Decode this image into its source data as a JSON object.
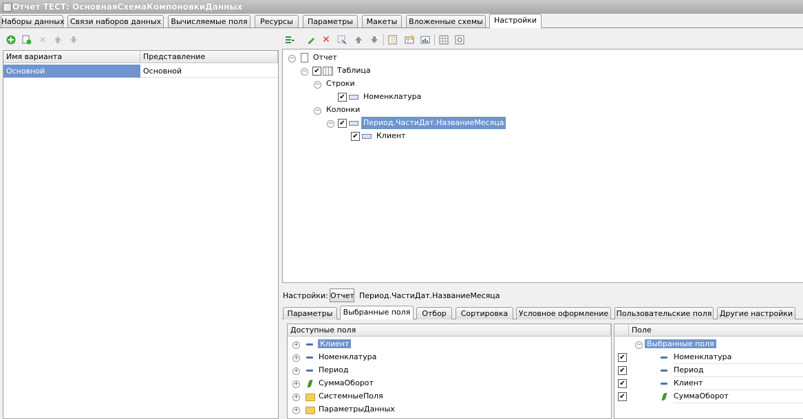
{
  "window": {
    "title": "Отчет ТЕСТ: ОсновнаяСхемаКомпоновкиДанных"
  },
  "tabs": [
    {
      "label": "Наборы данных"
    },
    {
      "label": "Связи наборов данных"
    },
    {
      "label": "Вычисляемые поля"
    },
    {
      "label": "Ресурсы"
    },
    {
      "label": "Параметры"
    },
    {
      "label": "Макеты"
    },
    {
      "label": "Вложенные схемы"
    },
    {
      "label": "Настройки"
    }
  ],
  "active_tab": "Настройки",
  "variants": {
    "col_name": "Имя варианта",
    "col_repr": "Представление",
    "rows": [
      {
        "name": "Основной",
        "repr": "Основной"
      }
    ]
  },
  "structure": {
    "root": "Отчет",
    "table": "Таблица",
    "rows_group": "Строки",
    "rows_field": "Номенклатура",
    "cols_group": "Колонки",
    "cols_field": "Период.ЧастиДат.НазваниеМесяца",
    "cols_subfield": "Клиент"
  },
  "settings_bar": {
    "label": "Настройки:",
    "btn_report": "Отчет",
    "current": "Период.ЧастиДат.НазваниеМесяца"
  },
  "subtabs": [
    {
      "label": "Параметры"
    },
    {
      "label": "Выбранные поля"
    },
    {
      "label": "Отбор"
    },
    {
      "label": "Сортировка"
    },
    {
      "label": "Условное оформление"
    },
    {
      "label": "Пользовательские поля"
    },
    {
      "label": "Другие настройки"
    }
  ],
  "available": {
    "header": "Доступные поля",
    "items": [
      {
        "label": "Клиент",
        "icon": "field-icon"
      },
      {
        "label": "Номенклатура",
        "icon": "field-icon"
      },
      {
        "label": "Период",
        "icon": "field-icon"
      },
      {
        "label": "СуммаОборот",
        "icon": "resource-icon"
      },
      {
        "label": "СистемныеПоля",
        "icon": "folder-icon"
      },
      {
        "label": "ПараметрыДанных",
        "icon": "folder-icon"
      }
    ]
  },
  "selected": {
    "header": "Поле",
    "group": "Выбранные поля",
    "items": [
      {
        "label": "Номенклатура",
        "icon": "field-icon"
      },
      {
        "label": "Период",
        "icon": "field-icon"
      },
      {
        "label": "Клиент",
        "icon": "field-icon"
      },
      {
        "label": "СуммаОборот",
        "icon": "resource-icon"
      }
    ]
  },
  "colors": {
    "selection": "#6f94cf",
    "title_bar": "#a9a9a9"
  }
}
